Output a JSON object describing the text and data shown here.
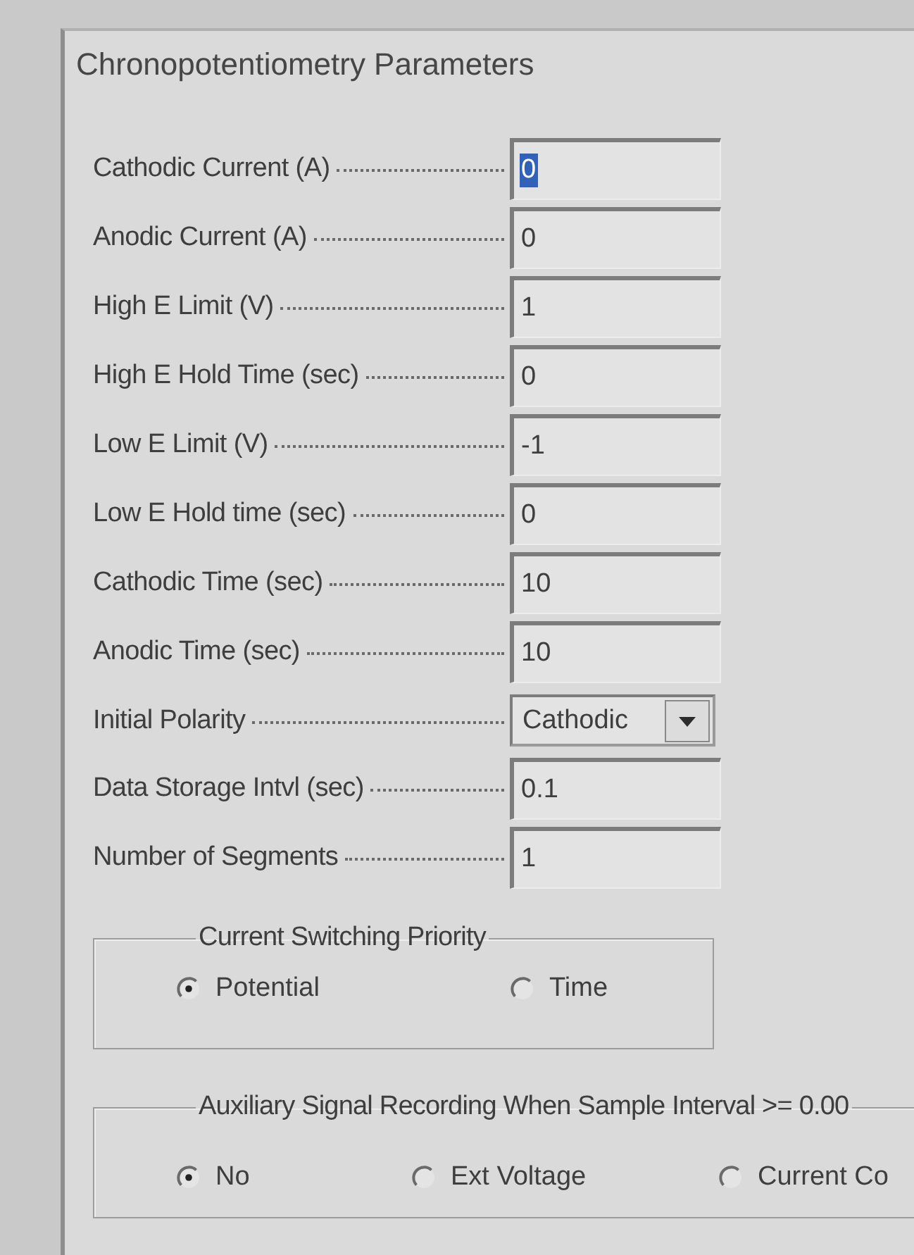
{
  "panel": {
    "title": "Chronopotentiometry Parameters"
  },
  "fields": [
    {
      "label": "Cathodic Current (A)",
      "kind": "text",
      "value": "0",
      "focused": true
    },
    {
      "label": "Anodic Current (A)",
      "kind": "text",
      "value": "0",
      "focused": false
    },
    {
      "label": "High E Limit (V)",
      "kind": "text",
      "value": "1",
      "focused": false
    },
    {
      "label": "High E Hold Time (sec)",
      "kind": "text",
      "value": "0",
      "focused": false
    },
    {
      "label": "Low E Limit (V)",
      "kind": "text",
      "value": "-1",
      "focused": false
    },
    {
      "label": "Low E Hold time (sec)",
      "kind": "text",
      "value": "0",
      "focused": false
    },
    {
      "label": "Cathodic Time (sec)",
      "kind": "text",
      "value": "10",
      "focused": false
    },
    {
      "label": "Anodic Time (sec)",
      "kind": "text",
      "value": "10",
      "focused": false
    },
    {
      "label": "Initial Polarity",
      "kind": "dropdown",
      "value": "Cathodic",
      "focused": false
    },
    {
      "label": "Data Storage Intvl (sec)",
      "kind": "text",
      "value": "0.1",
      "focused": false
    },
    {
      "label": "Number of Segments",
      "kind": "text",
      "value": "1",
      "focused": false
    }
  ],
  "groups": [
    {
      "title": "Current Switching Priority",
      "options": [
        {
          "label": "Potential",
          "selected": true
        },
        {
          "label": "Time",
          "selected": false
        }
      ]
    },
    {
      "title": "Auxiliary Signal Recording When Sample Interval >= 0.00",
      "options": [
        {
          "label": "No",
          "selected": true
        },
        {
          "label": "Ext Voltage",
          "selected": false
        },
        {
          "label": "Current Co",
          "selected": false
        }
      ]
    }
  ]
}
